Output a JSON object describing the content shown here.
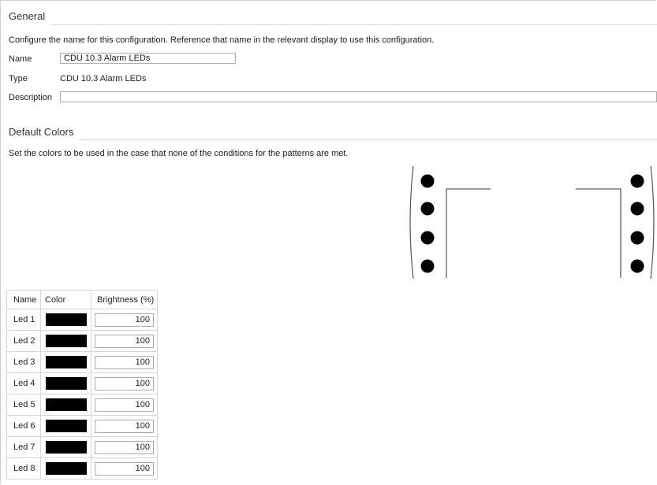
{
  "general": {
    "header": "General",
    "description_text": "Configure the name for this configuration. Reference that name in the relevant display to use this configuration.",
    "name_label": "Name",
    "name_value": "CDU 10.3 Alarm LEDs",
    "type_label": "Type",
    "type_value": "CDU 10.3 Alarm LEDs",
    "description_label": "Description",
    "description_value": ""
  },
  "default_colors": {
    "header": "Default Colors",
    "description_text": "Set the colors to be used in the case that none of the conditions for the patterns are met."
  },
  "table": {
    "columns": [
      "Name",
      "Color",
      "Brightness (%)"
    ],
    "rows": [
      {
        "name": "Led 1",
        "color": "#000000",
        "brightness": "100"
      },
      {
        "name": "Led 2",
        "color": "#000000",
        "brightness": "100"
      },
      {
        "name": "Led 3",
        "color": "#000000",
        "brightness": "100"
      },
      {
        "name": "Led 4",
        "color": "#000000",
        "brightness": "100"
      },
      {
        "name": "Led 5",
        "color": "#000000",
        "brightness": "100"
      },
      {
        "name": "Led 6",
        "color": "#000000",
        "brightness": "100"
      },
      {
        "name": "Led 7",
        "color": "#000000",
        "brightness": "100"
      },
      {
        "name": "Led 8",
        "color": "#000000",
        "brightness": "100"
      }
    ]
  }
}
